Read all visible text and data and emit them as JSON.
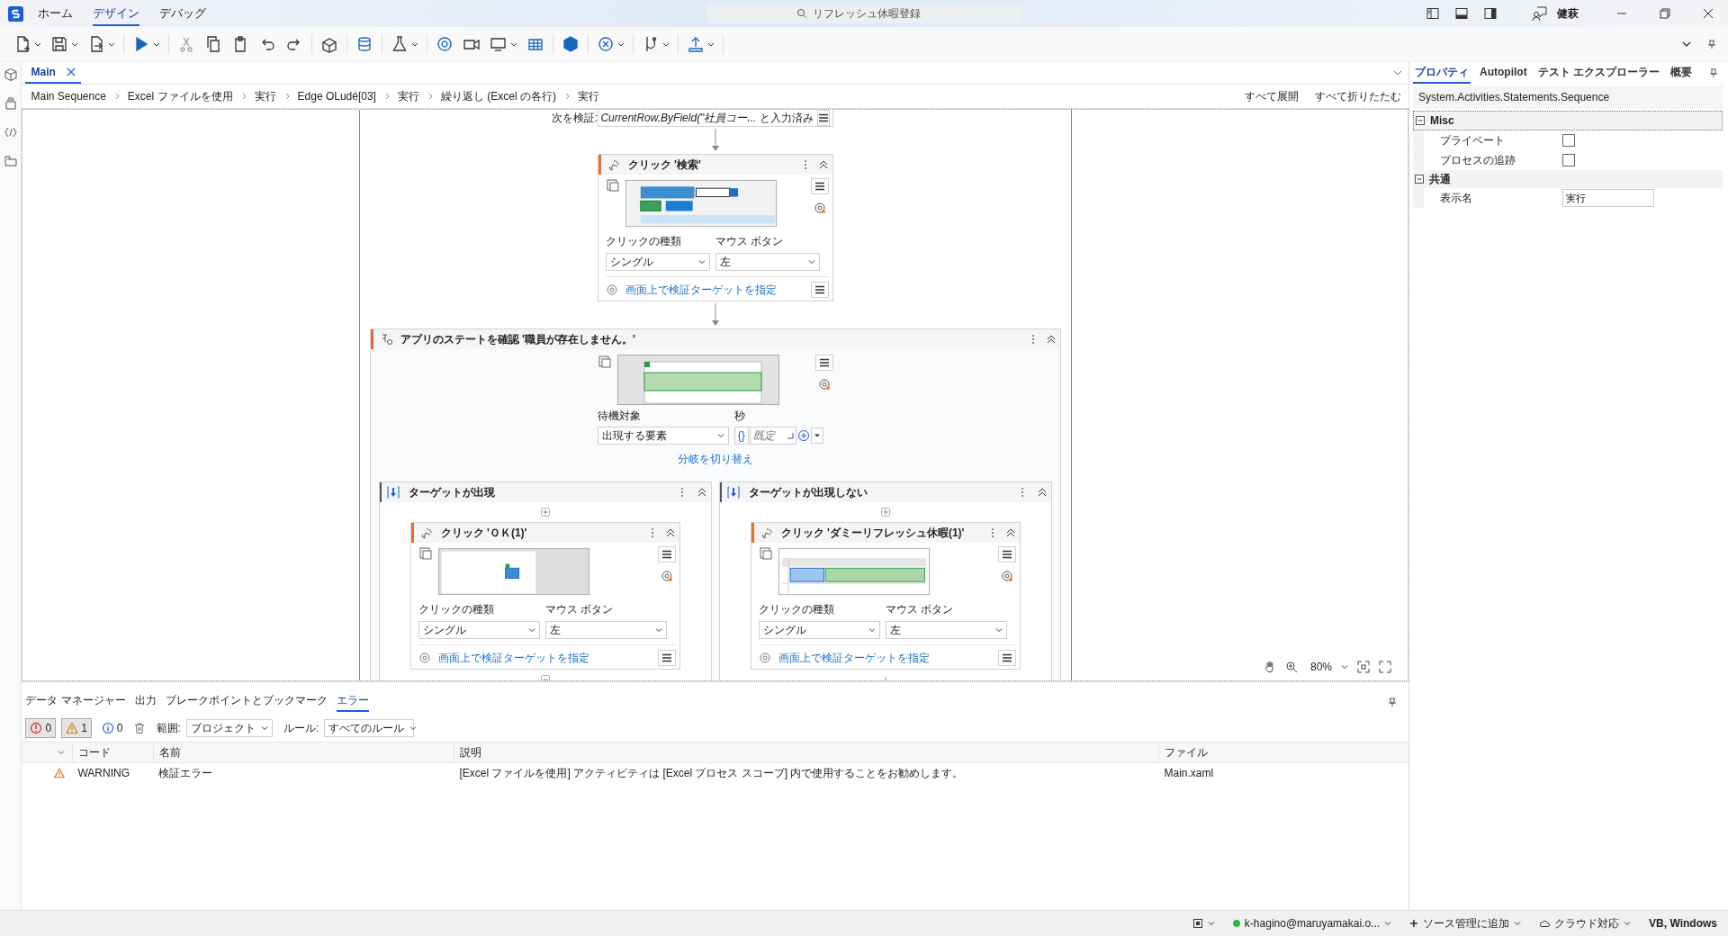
{
  "title_bar": {
    "menu_tabs": [
      {
        "label": "ホーム",
        "selected": false
      },
      {
        "label": "デザイン",
        "selected": true
      },
      {
        "label": "デバッグ",
        "selected": false
      }
    ],
    "search": {
      "placeholder": "リフレッシュ休暇登録"
    },
    "user": "健萩"
  },
  "document_tabs": [
    {
      "label": "Main",
      "selected": true
    }
  ],
  "breadcrumb": [
    "Main Sequence",
    "Excel ファイルを使用",
    "実行",
    "Edge OLudé[03]",
    "実行",
    "繰り返し (Excel の各行)",
    "実行"
  ],
  "breadcrumb_actions": [
    "すべて展開",
    "すべて折りたたむ"
  ],
  "canvas": {
    "validate_text": "次を検証: *CurrentRow.ByField(\"社員コー...* と入力済み",
    "click_activity": {
      "title": "クリック '検索'",
      "click_type_label": "クリックの種類",
      "click_type": "シングル",
      "mouse_button_label": "マウス ボタン",
      "mouse_button": "左",
      "verify_link": "画面上で検証ターゲットを指定"
    },
    "state_activity": {
      "title": "アプリのステートを確認 '職員が存在しません。'",
      "wait_label": "待機対象",
      "wait_value": "出現する要素",
      "seconds_label": "秒",
      "expression_glyph": "{}",
      "seconds_placeholder": "既定",
      "switch_link": "分岐を切り替え",
      "branches": [
        {
          "title": "ターゲットが出現",
          "has_next": false,
          "activity": {
            "title": "クリック 'ＯＫ(1)'",
            "click_type_label": "クリックの種類",
            "click_type": "シングル",
            "mouse_button_label": "マウス ボタン",
            "mouse_button": "左",
            "verify_link": "画面上で検証ターゲットを指定"
          }
        },
        {
          "title": "ターゲットが出現しない",
          "has_next": true,
          "activity": {
            "title": "クリック 'ダミーリフレッシュ休暇(1)'",
            "click_type_label": "クリックの種類",
            "click_type": "シングル",
            "mouse_button_label": "マウス ボタン",
            "mouse_button": "左",
            "verify_link": "画面上で検証ターゲットを指定"
          }
        }
      ]
    },
    "zoom": "80%"
  },
  "properties": {
    "tabs": [
      {
        "label": "プロパティ",
        "selected": true
      },
      {
        "label": "Autopilot",
        "selected": false
      },
      {
        "label": "テスト エクスプローラー",
        "selected": false
      },
      {
        "label": "概要",
        "selected": false
      }
    ],
    "type_name": "System.Activities.Statements.Sequence",
    "categories": [
      {
        "name": "Misc",
        "expanded": true,
        "rows": [
          {
            "kind": "checkbox",
            "label": "プライベート",
            "checked": false
          },
          {
            "kind": "checkbox",
            "label": "プロセスの追跡",
            "checked": false
          }
        ]
      },
      {
        "name": "共通",
        "expanded": true,
        "rows": [
          {
            "kind": "text",
            "label": "表示名",
            "value": "実行"
          }
        ]
      }
    ]
  },
  "bottom_panel": {
    "tabs": [
      {
        "label": "データ マネージャー",
        "selected": false
      },
      {
        "label": "出力",
        "selected": false
      },
      {
        "label": "ブレークポイントとブックマーク",
        "selected": false
      },
      {
        "label": "エラー",
        "selected": true
      }
    ],
    "filters": [
      {
        "kind": "error",
        "count": "0",
        "selected": true
      },
      {
        "kind": "warning",
        "count": "1",
        "selected": true
      },
      {
        "kind": "info",
        "count": "0",
        "selected": false
      }
    ],
    "scope_label": "範囲:",
    "scope": "プロジェクト",
    "rule_label": "ルール:",
    "rule": "すべてのルール",
    "columns": [
      "コード",
      "名前",
      "説明",
      "ファイル"
    ],
    "rows": [
      {
        "kind": "warning",
        "code": "WARNING",
        "name": "検証エラー",
        "description": "[Excel ファイルを使用] アクティビティは [Excel プロセス スコープ] 内で使用することをお勧めします。",
        "file": "Main.xaml"
      }
    ]
  },
  "status_bar": {
    "account": "k-hagino@maruyamakai.o...",
    "source_control": "ソース管理に追加",
    "cloud": "クラウド対応",
    "language": "VB, Windows"
  }
}
